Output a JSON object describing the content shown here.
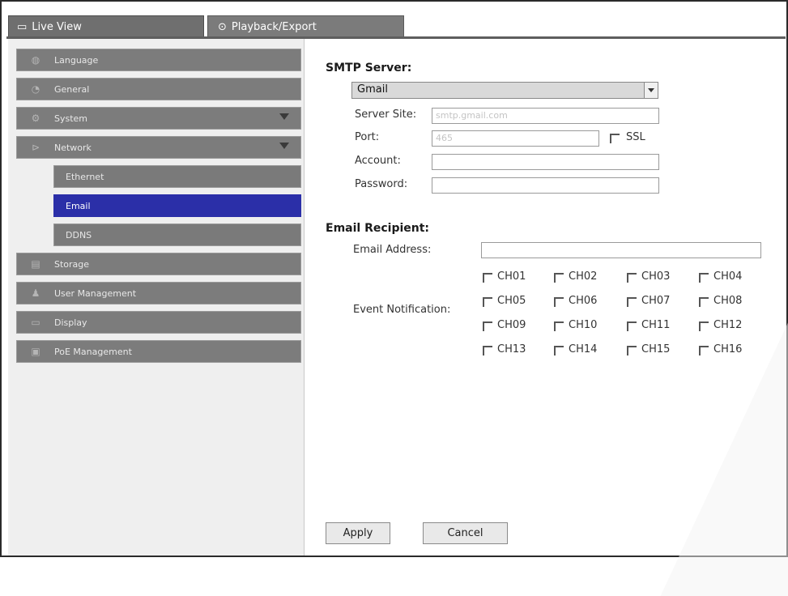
{
  "tabs": [
    {
      "label": "Live View",
      "icon": "monitor-icon"
    },
    {
      "label": "Playback/Export",
      "icon": "play-circle-icon"
    }
  ],
  "sidebar": {
    "items": [
      {
        "label": "Language",
        "icon": "globe-icon"
      },
      {
        "label": "General",
        "icon": "gauge-icon"
      },
      {
        "label": "System",
        "icon": "gear-icon",
        "expandable": true
      },
      {
        "label": "Network",
        "icon": "network-icon",
        "expandable": true
      },
      {
        "label": "Storage",
        "icon": "storage-icon"
      },
      {
        "label": "User Management",
        "icon": "user-icon"
      },
      {
        "label": "Display",
        "icon": "display-icon"
      },
      {
        "label": "PoE Management",
        "icon": "poe-icon"
      }
    ],
    "network_sub": [
      {
        "label": "Ethernet",
        "active": false
      },
      {
        "label": "Email",
        "active": true
      },
      {
        "label": "DDNS",
        "active": false
      }
    ]
  },
  "smtp": {
    "heading": "SMTP Server:",
    "provider": "Gmail",
    "server_site_label": "Server Site:",
    "server_site_value": "smtp.gmail.com",
    "port_label": "Port:",
    "port_value": "465",
    "ssl_label": "SSL",
    "ssl_checked": true,
    "account_label": "Account:",
    "account_value": "",
    "password_label": "Password:",
    "password_value": ""
  },
  "recipient": {
    "heading": "Email Recipient:",
    "address_label": "Email Address:",
    "address_value": "",
    "event_label": "Event Notification:",
    "channels": [
      "CH01",
      "CH02",
      "CH03",
      "CH04",
      "CH05",
      "CH06",
      "CH07",
      "CH08",
      "CH09",
      "CH10",
      "CH11",
      "CH12",
      "CH13",
      "CH14",
      "CH15",
      "CH16"
    ]
  },
  "buttons": {
    "apply": "Apply",
    "cancel": "Cancel"
  },
  "colors": {
    "active_item": "#2b2fa8",
    "sidebar_item": "#7c7c7c"
  }
}
